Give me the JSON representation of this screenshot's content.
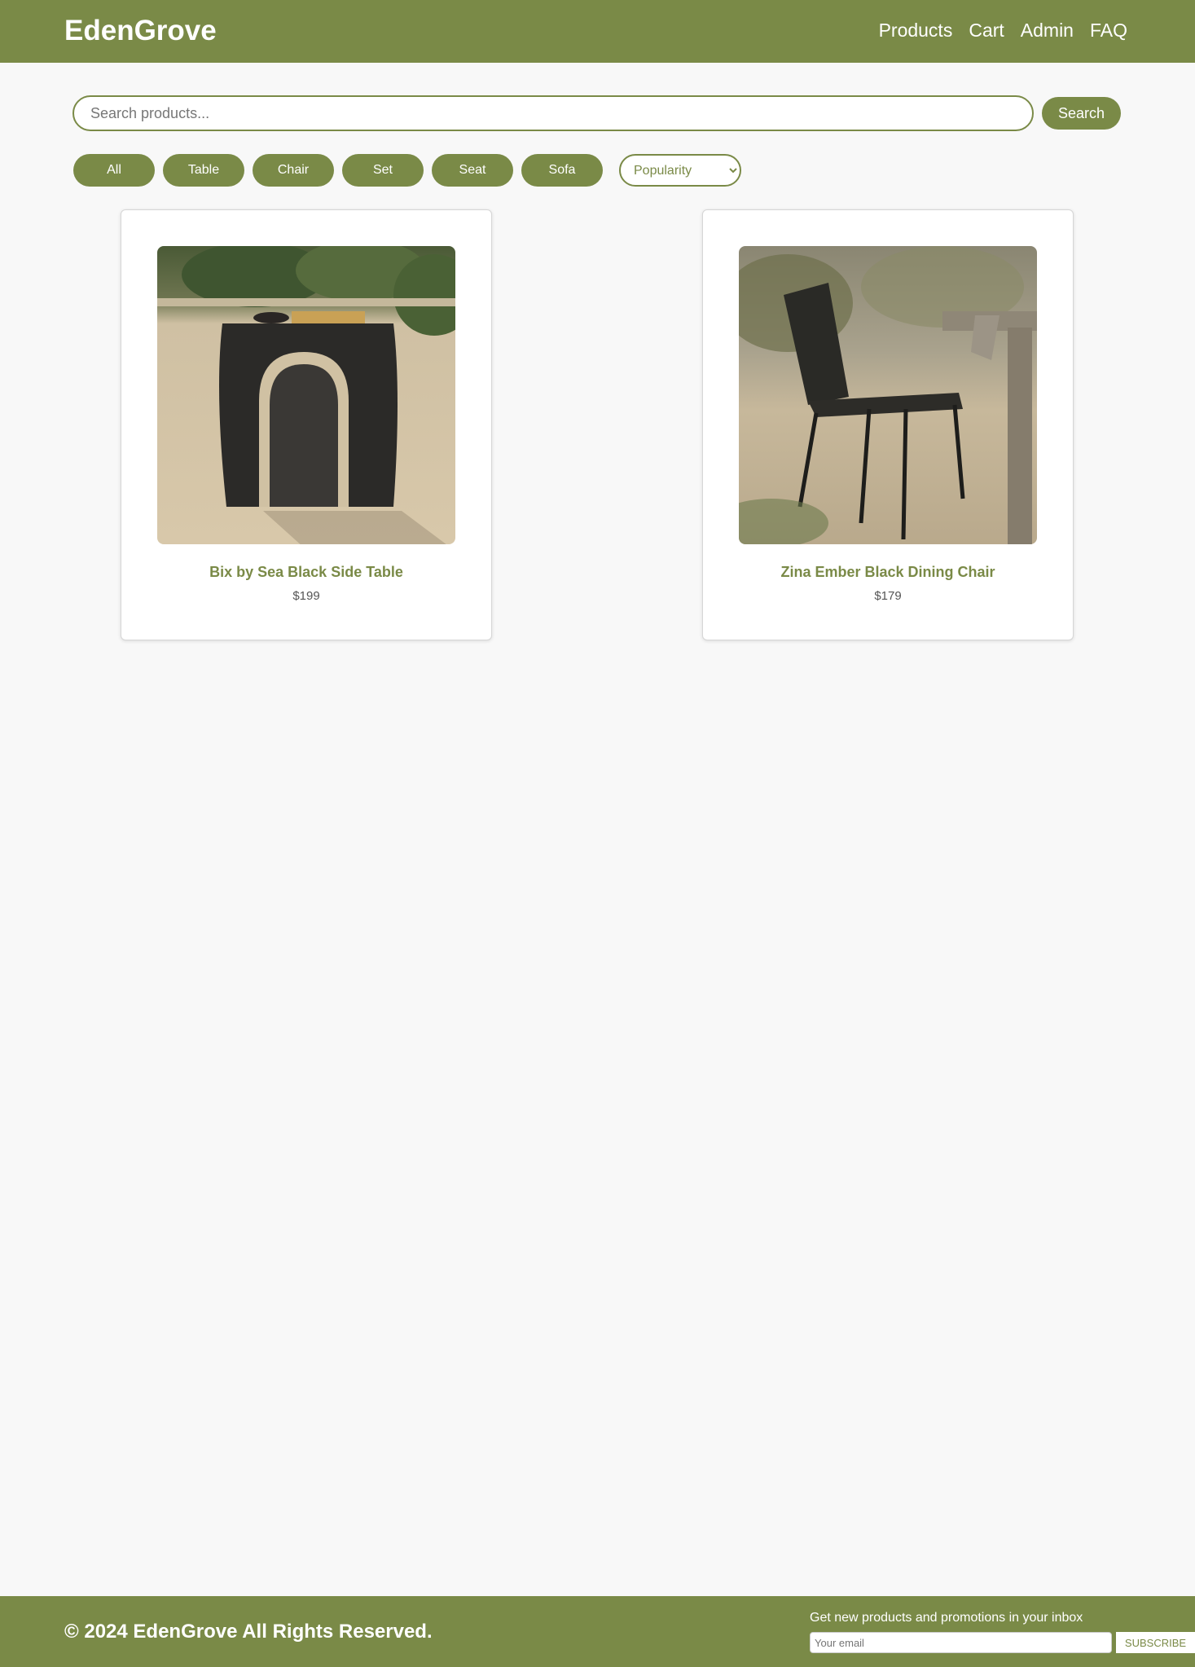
{
  "header": {
    "brand": "EdenGrove",
    "nav": [
      "Products",
      "Cart",
      "Admin",
      "FAQ"
    ]
  },
  "search": {
    "placeholder": "Search products...",
    "value": "",
    "button_label": "Search"
  },
  "filters": [
    "All",
    "Table",
    "Chair",
    "Set",
    "Seat",
    "Sofa"
  ],
  "sort": {
    "selected": "Popularity"
  },
  "products": [
    {
      "name": "Bix by Sea Black Side Table",
      "price": "$199"
    },
    {
      "name": "Zina Ember Black Dining Chair",
      "price": "$179"
    }
  ],
  "footer": {
    "copyright": "© 2024 EdenGrove All Rights Reserved.",
    "newsletter_label": "Get new products and promotions in your inbox",
    "email_placeholder": "Your email",
    "subscribe_label": "SUBSCRIBE"
  },
  "colors": {
    "brand_green": "#7a8a47",
    "page_background": "#f8f8f8"
  }
}
